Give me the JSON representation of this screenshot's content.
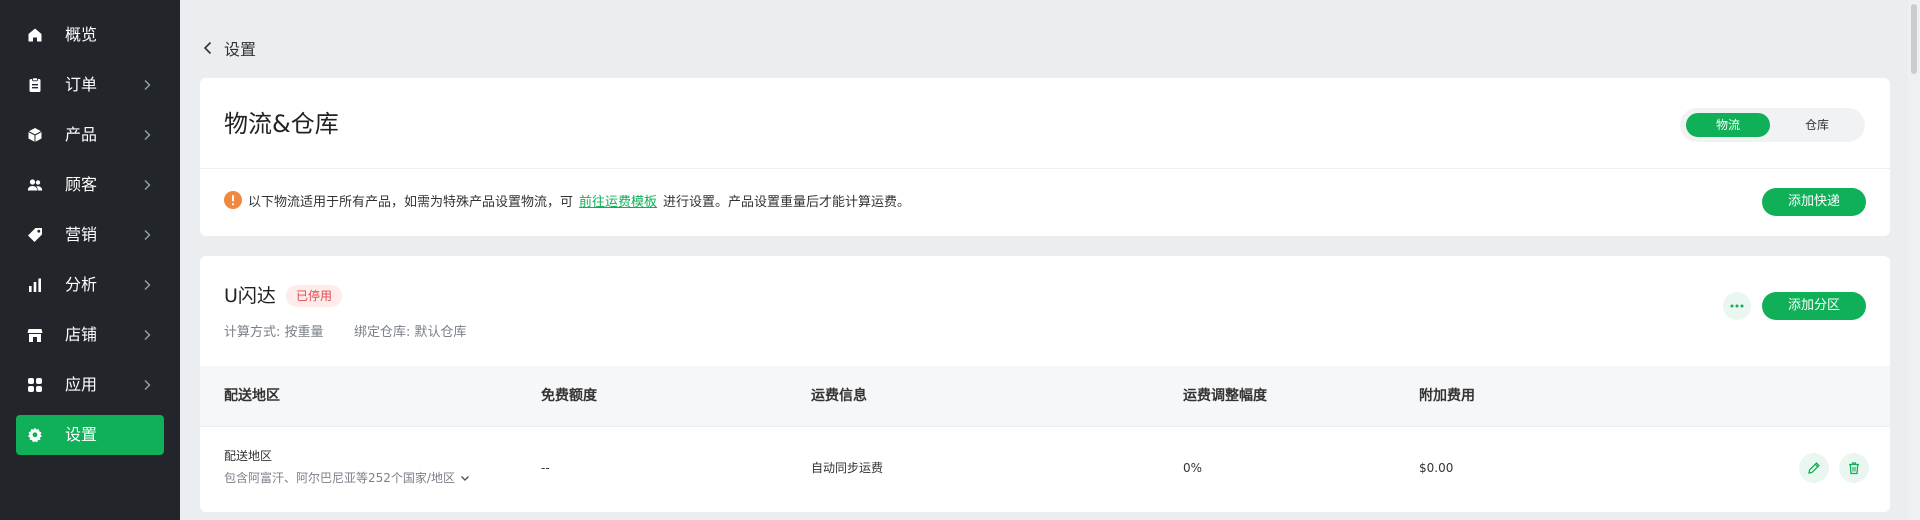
{
  "sidebar": {
    "items": [
      {
        "label": "概览",
        "icon": "home-icon"
      },
      {
        "label": "订单",
        "icon": "clipboard-icon"
      },
      {
        "label": "产品",
        "icon": "box-icon"
      },
      {
        "label": "顾客",
        "icon": "users-icon"
      },
      {
        "label": "营销",
        "icon": "tag-icon"
      },
      {
        "label": "分析",
        "icon": "bar-chart-icon"
      },
      {
        "label": "店铺",
        "icon": "store-icon"
      },
      {
        "label": "应用",
        "icon": "apps-icon"
      },
      {
        "label": "设置",
        "icon": "gear-icon"
      }
    ],
    "active_item": "设置",
    "colors": {
      "background": "#22262b",
      "active": "#0fb057"
    }
  },
  "breadcrumb": {
    "back_label": "设置"
  },
  "header": {
    "title": "物流&仓库",
    "segment": {
      "options": [
        "物流",
        "仓库"
      ],
      "selected": "物流"
    }
  },
  "notice": {
    "text_before": "以下物流适用于所有产品，如需为特殊产品设置物流，可",
    "link": "前往运费模板",
    "text_after": "进行设置。产品设置重量后才能计算运费。",
    "icon": "warning-icon"
  },
  "add_express_button": "添加快递",
  "carrier": {
    "name": "U闪达",
    "status_badge": "已停用",
    "calc_method": "计算方式: 按重量",
    "bound_warehouse": "绑定仓库: 默认仓库",
    "add_zone_button": "添加分区",
    "more_icon": "more-icon"
  },
  "table": {
    "columns": [
      "配送地区",
      "免费额度",
      "运费信息",
      "运费调整幅度",
      "附加费用"
    ],
    "rows": [
      {
        "region_title": "配送地区",
        "region_desc": "包含阿富汗、阿尔巴尼亚等252个国家/地区",
        "free_quota": "--",
        "shipping_info": "自动同步运费",
        "adjustment": "0%",
        "extra_fee": "$0.00"
      }
    ]
  },
  "accent_color": "#0fb057"
}
